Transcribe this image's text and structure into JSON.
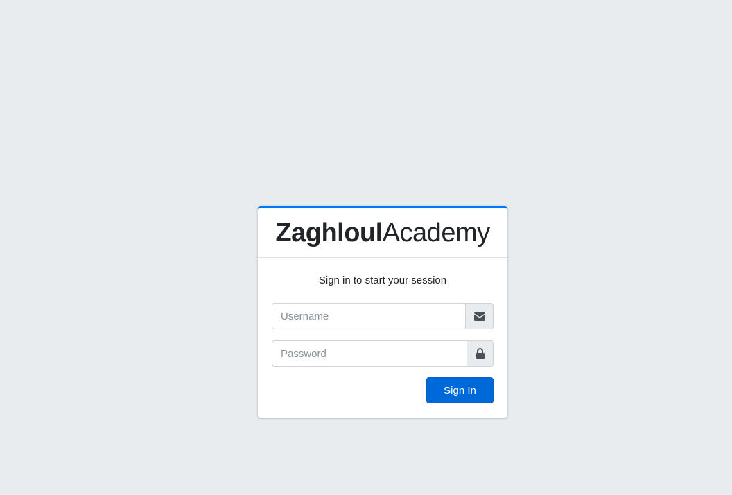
{
  "brand": {
    "bold": "Zaghloul",
    "light": "Academy"
  },
  "login": {
    "message": "Sign in to start your session",
    "username_placeholder": "Username",
    "username_value": "",
    "username_icon": "envelope-icon",
    "password_placeholder": "Password",
    "password_value": "",
    "password_icon": "lock-icon",
    "submit_label": "Sign In"
  },
  "colors": {
    "background": "#e9ecef",
    "accent": "#007bff",
    "button": "#0069d9"
  }
}
